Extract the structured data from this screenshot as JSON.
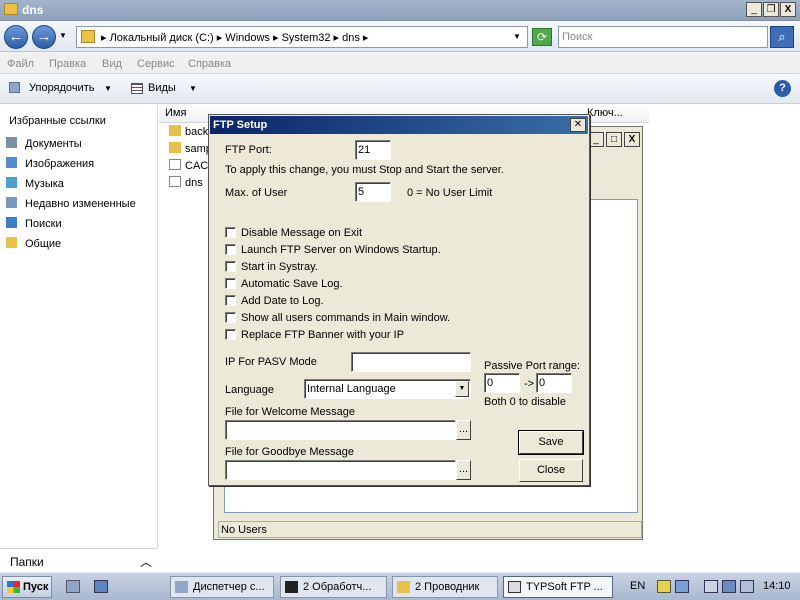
{
  "window": {
    "title": "dns"
  },
  "address": {
    "path": "▸ Локальный диск (C:) ▸ Windows ▸ System32 ▸ dns ▸",
    "search_placeholder": "Поиск"
  },
  "menu": [
    "Файл",
    "Правка",
    "Вид",
    "Сервис",
    "Справка"
  ],
  "toolbar": {
    "organize": "Упорядочить",
    "views": "Виды"
  },
  "nav": {
    "favorites_header": "Избранные ссылки",
    "items": [
      "Документы",
      "Изображения",
      "Музыка",
      "Недавно измененные",
      "Поиски",
      "Общие"
    ],
    "folders": "Папки"
  },
  "columns": [
    "Имя",
    "Ключ..."
  ],
  "files": [
    "back",
    "samp",
    "CACI",
    "dns"
  ],
  "app_window": {
    "status": "No Users"
  },
  "ftp_setup": {
    "title": "FTP Setup",
    "ftp_port_label": "FTP Port:",
    "ftp_port_value": "21",
    "restart_note": "To apply this change, you must Stop and Start the server.",
    "max_user_label": "Max. of User",
    "max_user_value": "5",
    "max_user_hint": "0 = No User Limit",
    "checkboxes": [
      "Disable Message on Exit",
      "Launch FTP Server on Windows Startup.",
      "Start in Systray.",
      "Automatic Save Log.",
      "Add Date to Log.",
      "Show all users commands in Main window.",
      "Replace FTP Banner with your IP"
    ],
    "pasv_label": "IP For PASV Mode",
    "pasv_value": "",
    "port_range_label": "Passive Port range:",
    "port_from": "0",
    "port_arrow": "->",
    "port_to": "0",
    "port_hint": "Both 0 to disable",
    "language_label": "Language",
    "language_value": "Internal Language",
    "welcome_label": "File for Welcome Message",
    "welcome_value": "",
    "goodbye_label": "File for Goodbye Message",
    "goodbye_value": "",
    "browse": "...",
    "save": "Save",
    "close": "Close"
  },
  "taskbar": {
    "start": "Пуск",
    "tasks": [
      "Диспетчер с...",
      "2 Обработч...",
      "2 Проводник",
      "TYPSoft FTP ..."
    ],
    "lang": "EN",
    "time": "14:10"
  }
}
